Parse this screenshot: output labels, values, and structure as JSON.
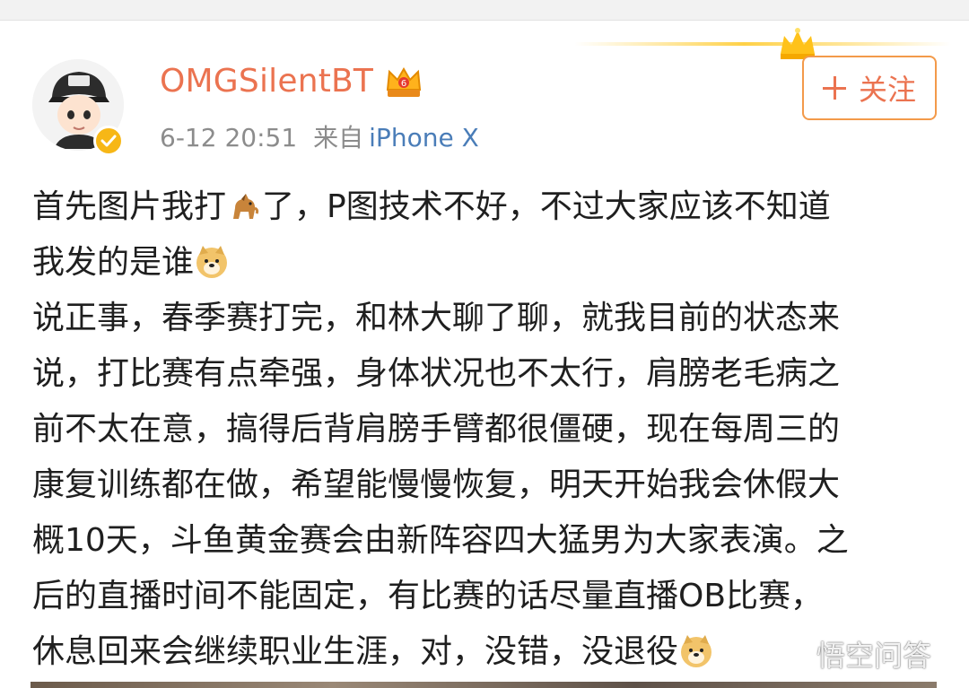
{
  "post": {
    "username": "OMGSilentBT",
    "date": "6-12 20:51",
    "source_label": "来自",
    "device": "iPhone X",
    "follow_label": "关注",
    "lines": [
      {
        "text": "首先图片我打",
        "emoji": "horse-emoji",
        "after": "了，P图技术不好，不过大家应该不知道"
      },
      {
        "text": "我发的是谁",
        "emoji": "doge-emoji",
        "after": ""
      },
      {
        "text": "说正事，春季赛打完，和林大聊了聊，就我目前的状态来",
        "emoji": "",
        "after": ""
      },
      {
        "text": "说，打比赛有点牵强，身体状况也不太行，肩膀老毛病之",
        "emoji": "",
        "after": ""
      },
      {
        "text": "前不太在意，搞得后背肩膀手臂都很僵硬，现在每周三的",
        "emoji": "",
        "after": ""
      },
      {
        "text": "康复训练都在做，希望能慢慢恢复，明天开始我会休假大",
        "emoji": "",
        "after": ""
      },
      {
        "text": "概10天，斗鱼黄金赛会由新阵容四大猛男为大家表演。之",
        "emoji": "",
        "after": ""
      },
      {
        "text": "后的直播时间不能固定，有比赛的话尽量直播OB比赛，",
        "emoji": "",
        "after": ""
      },
      {
        "text": "休息回来会继续职业生涯，对，没错，没退役",
        "emoji": "doge-emoji",
        "after": ""
      }
    ]
  },
  "watermark": {
    "text": "悟空问答",
    "icon": "wukong-logo-icon"
  },
  "colors": {
    "username": "#eb7350",
    "device_link": "#4a7db8",
    "follow_border": "#f39a4a",
    "meta_gray": "#8c8c8c",
    "verified_gold": "#f7b716"
  }
}
